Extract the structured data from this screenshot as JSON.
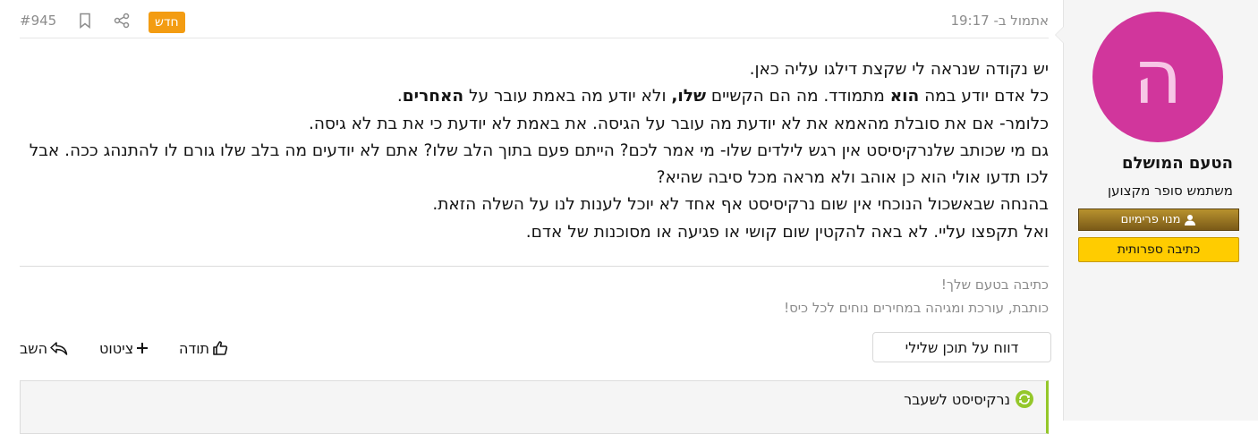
{
  "post": {
    "number": "#945",
    "timestamp": "אתמול ב- 19:17",
    "new_label": "חדש",
    "icons": {
      "bookmark": "bookmark-icon",
      "share": "share-icon"
    }
  },
  "author": {
    "avatar_letter": "ה",
    "avatar_color": "#d1369c",
    "name": "הטעם המושלם",
    "title": "משתמש סופר מקצוען",
    "premium_badge": "מנוי פרימיום",
    "literary_badge": "כתיבה ספרותית"
  },
  "body": {
    "l1": "יש נקודה שנראה לי שקצת דילגו עליה כאן.",
    "l2_a": "כל אדם יודע במה ",
    "l2_b": "הוא",
    "l2_c": " מתמודד. מה הם הקשיים ",
    "l2_d": "שלו,",
    "l2_e": " ולא יודע מה באמת עובר על ",
    "l2_f": "האחרים",
    "l2_g": ".",
    "l3": "כלומר- אם את סובלת מהאמא את לא יודעת מה עובר על הגיסה. את באמת לא יודעת כי את בת לא גיסה.",
    "l4": "גם מי שכותב שלנרקיסיסט אין רגש לילדים שלו- מי אמר לכם? הייתם פעם בתוך הלב שלו? אתם לא יודעים מה בלב שלו גורם לו להתנהג ככה. אבל לכו תדעו אולי הוא כן אוהב ולא מראה מכל סיבה שהיא?",
    "l5": "בהנחה שבאשכול הנוכחי אין שום נרקיסיסט אף אחד לא יוכל לענות לנו על השלה הזאת.",
    "l6": "ואל תקפצו עליי. לא באה להקטין שום קושי או פגיעה או מסוכנות של אדם."
  },
  "signature": {
    "line1": "כתיבה בטעם שלך!",
    "line2": "כותבת, עורכת ומגיהה במחירים נוחים לכל כיס!"
  },
  "actions": {
    "report": "דווח על תוכן שלילי",
    "like": "תודה",
    "quote": "ציטוט",
    "reply": "השב"
  },
  "linked_thread": {
    "title": "נרקיסיסט לשעבר",
    "accent": "#94c72a"
  }
}
